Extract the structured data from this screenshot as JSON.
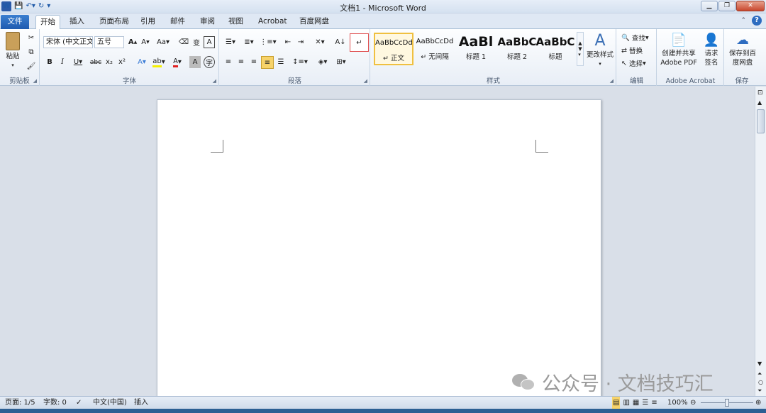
{
  "window": {
    "title": "文档1 - Microsoft Word"
  },
  "tabs": [
    "文件",
    "开始",
    "插入",
    "页面布局",
    "引用",
    "邮件",
    "审阅",
    "视图",
    "Acrobat",
    "百度网盘"
  ],
  "clipboard": {
    "paste": "粘贴",
    "label": "剪贴板"
  },
  "font": {
    "name": "宋体 (中文正文)",
    "size": "五号",
    "label": "字体",
    "aa": "Aa"
  },
  "paragraph": {
    "label": "段落"
  },
  "styles": {
    "label": "样式",
    "items": [
      {
        "sample": "AaBbCcDd",
        "name": "正文"
      },
      {
        "sample": "AaBbCcDd",
        "name": "无间隔"
      },
      {
        "sample": "AaBl",
        "name": "标题 1"
      },
      {
        "sample": "AaBbC",
        "name": "标题 2"
      },
      {
        "sample": "AaBbC",
        "name": "标题"
      }
    ],
    "change": "更改样式"
  },
  "editing": {
    "find": "查找",
    "replace": "替换",
    "select": "选择",
    "label": "编辑"
  },
  "acrobat": {
    "create": "创建并共享",
    "create2": "Adobe PDF",
    "sign": "请求",
    "sign2": "签名",
    "label": "Adobe Acrobat"
  },
  "save": {
    "l1": "保存到百",
    "l2": "度网盘",
    "label": "保存"
  },
  "status": {
    "page": "页面: 1/5",
    "words": "字数: 0",
    "lang": "中文(中国)",
    "mode": "插入",
    "zoom": "100%"
  },
  "watermark": "公众号 · 文档技巧汇",
  "colors": {
    "accent": "#1f5bb0",
    "highlight": "#f0c040",
    "font_red": "#e02020"
  }
}
